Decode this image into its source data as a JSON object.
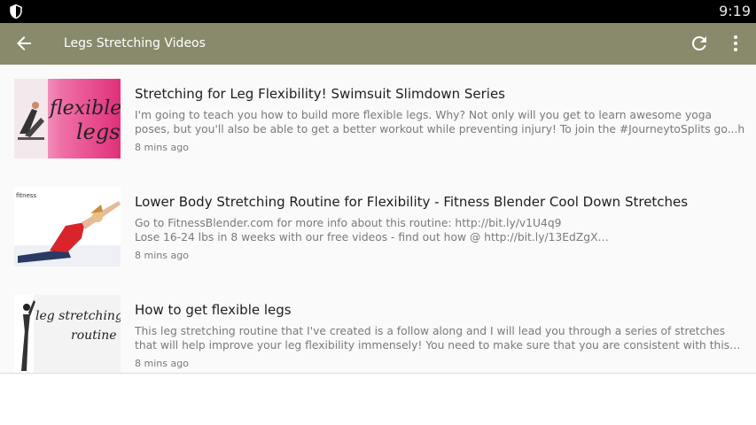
{
  "status_bar": {
    "time": "9:19",
    "shield_icon": "shield-icon"
  },
  "app_bar": {
    "title": "Legs Stretching Videos",
    "back_icon": "arrow-back-icon",
    "refresh_icon": "refresh-icon",
    "more_icon": "more-vert-icon",
    "color": "#898a6b"
  },
  "videos": [
    {
      "title": "Stretching for Leg Flexibility! Swimsuit Slimdown Series",
      "description_line1": "I'm going to teach you how to build more flexible legs. Why? Not only will you get to learn awesome yoga",
      "description_line2": "poses, but you'll also be able to get a better workout while preventing injury! To join the #JourneytoSplits go...h",
      "age": "8 mins ago",
      "thumb_text_1": "flexible",
      "thumb_text_2": "legs"
    },
    {
      "title": "Lower Body Stretching Routine for Flexibility - Fitness Blender Cool Down Stretches",
      "description_line1": "Go to FitnessBlender.com for more info about this routine: http://bit.ly/v1U4q9",
      "description_line2": "Lose 16-24 lbs in 8 weeks with our free videos - find out how @ http://bit.ly/13EdZgX…",
      "age": "8 mins ago",
      "thumb_text_1": "fitness"
    },
    {
      "title": "How to get flexible legs",
      "description_line1": "This leg stretching routine that I've created is a follow along and I will lead you through a series of stretches",
      "description_line2": "that will help improve your leg flexibility immensely! You need to make sure that you are consistent with this…",
      "age": "8 mins ago",
      "thumb_text_1": "leg stretching",
      "thumb_text_2": "routine"
    }
  ]
}
